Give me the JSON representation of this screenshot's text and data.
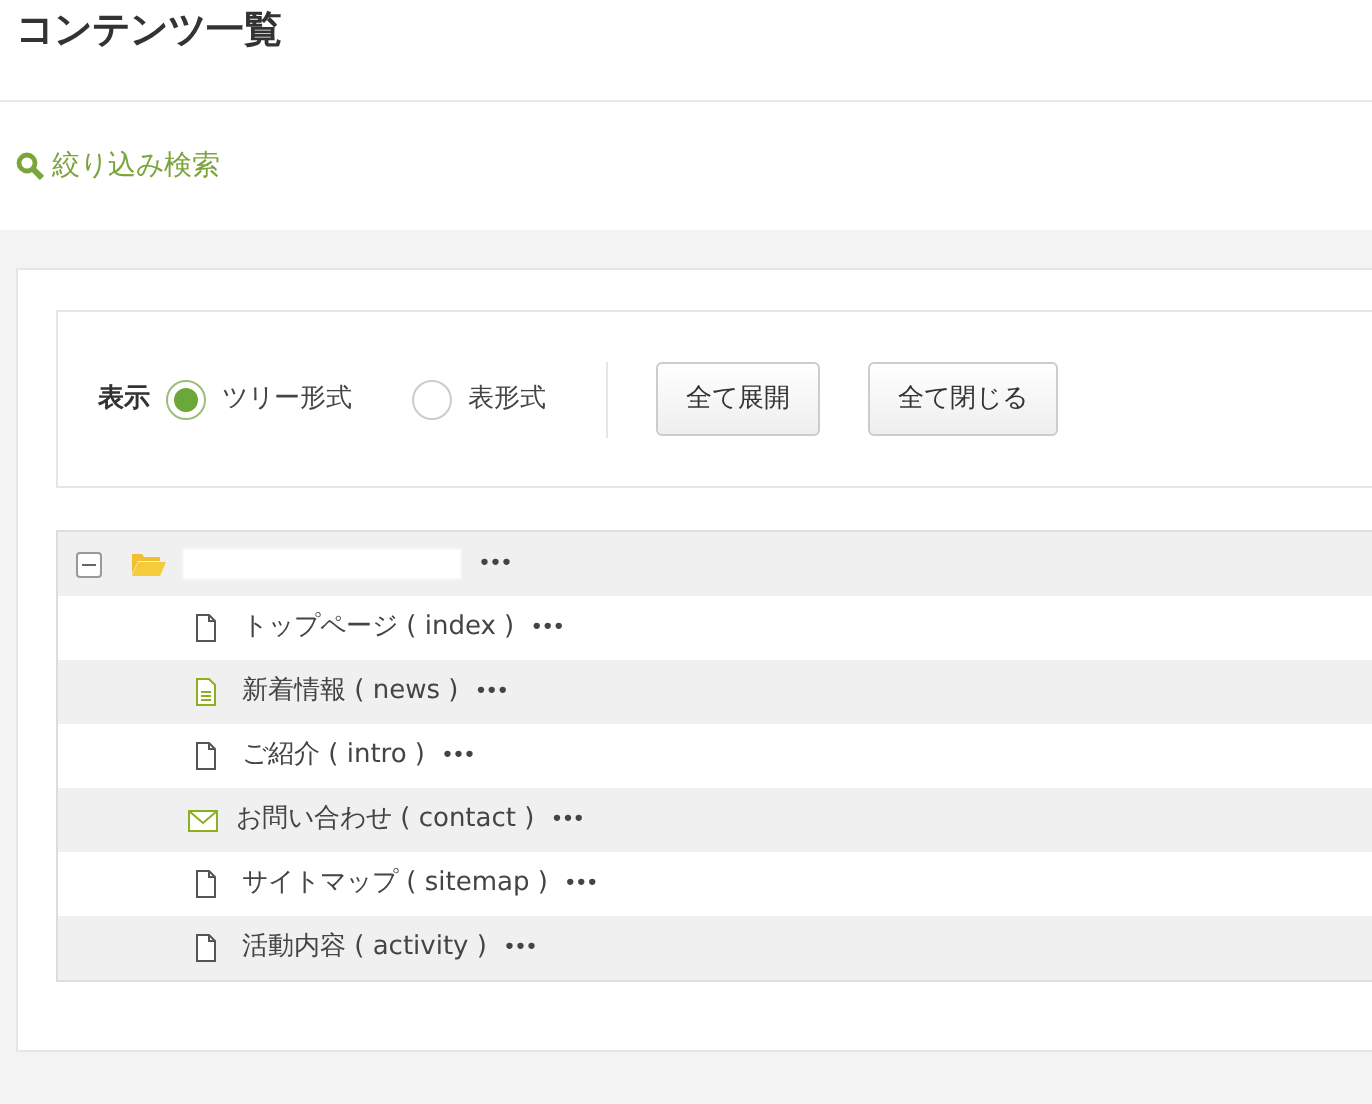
{
  "page_title": "コンテンツ一覧",
  "filter_link": "絞り込み検索",
  "view": {
    "label": "表示",
    "options": [
      {
        "label": "ツリー形式",
        "selected": true
      },
      {
        "label": "表形式",
        "selected": false
      }
    ],
    "buttons": [
      "全て展開",
      "全て閉じる"
    ]
  },
  "tree": {
    "root": {
      "expanded": true,
      "menu": "•••",
      "children": [
        {
          "kind": "page",
          "label": "トップページ ( index )",
          "menu": "•••"
        },
        {
          "kind": "article",
          "label": "新着情報 ( news )",
          "menu": "•••"
        },
        {
          "kind": "page",
          "label": "ご紹介 ( intro )",
          "menu": "•••"
        },
        {
          "kind": "mail",
          "label": "お問い合わせ ( contact )",
          "menu": "•••"
        },
        {
          "kind": "page",
          "label": "サイトマップ ( sitemap )",
          "menu": "•••"
        },
        {
          "kind": "page",
          "label": "活動内容 ( activity )",
          "menu": "•••"
        }
      ]
    }
  }
}
